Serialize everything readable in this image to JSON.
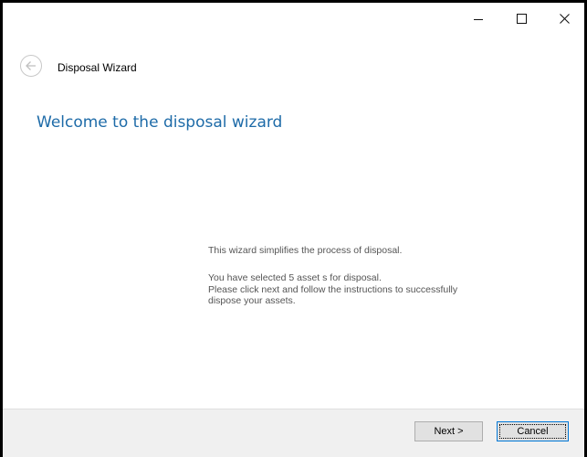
{
  "window": {
    "controls": {
      "minimize": "minimize-icon",
      "maximize": "maximize-icon",
      "close": "close-icon"
    }
  },
  "header": {
    "back_icon": "back-arrow-icon",
    "title": "Disposal Wizard"
  },
  "main": {
    "heading": "Welcome to the disposal wizard",
    "intro": "This wizard simplifies the process of disposal.",
    "selection": "You have selected 5 asset s for disposal.",
    "instruction_line1": "Please click next and follow the instructions to successfully",
    "instruction_line2": "dispose your assets."
  },
  "footer": {
    "next_label": "Next >",
    "cancel_label": "Cancel"
  },
  "colors": {
    "heading": "#1e6ba8",
    "footer_bg": "#f0f0f0",
    "focus_border": "#0078d7"
  }
}
